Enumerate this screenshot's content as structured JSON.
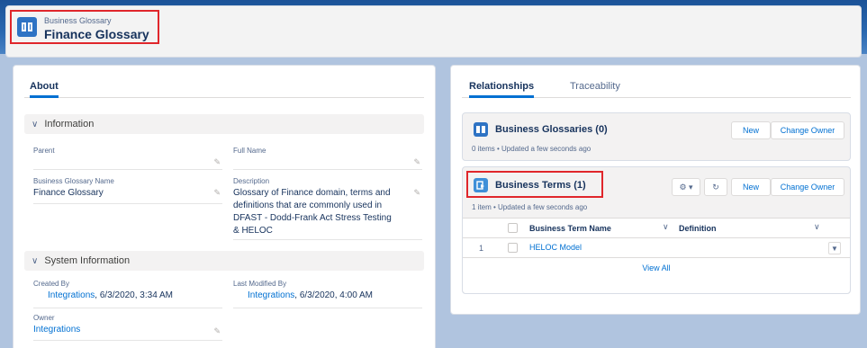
{
  "header": {
    "object_type": "Business Glossary",
    "record_name": "Finance Glossary"
  },
  "left": {
    "tab_label": "About",
    "information": {
      "header": "Information",
      "parent_label": "Parent",
      "parent_value": "",
      "full_name_label": "Full Name",
      "full_name_value": "",
      "bg_name_label": "Business Glossary Name",
      "bg_name_value": "Finance Glossary",
      "description_label": "Description",
      "description_value": "Glossary of Finance domain, terms and definitions that are commonly used in DFAST - Dodd-Frank Act Stress Testing & HELOC"
    },
    "system": {
      "header": "System Information",
      "created_by_label": "Created By",
      "created_by_link": "Integrations",
      "created_by_date": ", 6/3/2020, 3:34 AM",
      "modified_by_label": "Last Modified By",
      "modified_by_link": "Integrations",
      "modified_by_date": ", 6/3/2020, 4:00 AM",
      "owner_label": "Owner",
      "owner_value": "Integrations"
    }
  },
  "right": {
    "tabs": [
      "Relationships",
      "Traceability"
    ],
    "glossaries": {
      "title": "Business Glossaries (0)",
      "meta": "0 items • Updated a few seconds ago",
      "new_label": "New",
      "change_owner_label": "Change Owner"
    },
    "terms": {
      "title": "Business Terms (1)",
      "meta": "1 item • Updated a few seconds ago",
      "new_label": "New",
      "change_owner_label": "Change Owner",
      "columns": [
        "Business Term Name",
        "Definition"
      ],
      "rows": [
        {
          "num": "1",
          "name": "HELOC Model",
          "definition": ""
        }
      ],
      "view_all": "View All"
    }
  },
  "colors": {
    "accent": "#0070d2",
    "highlight": "#e0262b",
    "glossary_icon": "#2e73c4",
    "terms_icon": "#3f8fd8"
  },
  "icons": [
    "book-icon",
    "chevron-down-icon",
    "pencil-icon",
    "gear-icon",
    "refresh-icon",
    "term-icon"
  ]
}
